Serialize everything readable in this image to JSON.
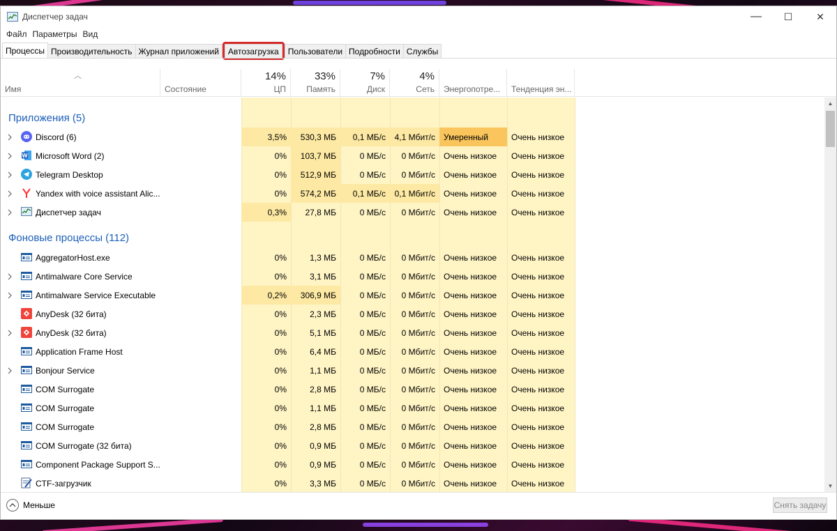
{
  "window": {
    "title": "Диспетчер задач",
    "minimize": "—",
    "maximize": "☐",
    "close": "✕"
  },
  "menu": [
    "Файл",
    "Параметры",
    "Вид"
  ],
  "tabs": [
    "Процессы",
    "Производительность",
    "Журнал приложений",
    "Автозагрузка",
    "Пользователи",
    "Подробности",
    "Службы"
  ],
  "active_tab": "Процессы",
  "highlighted_tab": "Автозагрузка",
  "columns": {
    "name": "Имя",
    "status": "Состояние",
    "cpu": {
      "pct": "14%",
      "label": "ЦП"
    },
    "memory": {
      "pct": "33%",
      "label": "Память"
    },
    "disk": {
      "pct": "7%",
      "label": "Диск"
    },
    "network": {
      "pct": "4%",
      "label": "Сеть"
    },
    "power": "Энергопотре...",
    "trend": "Тенденция эн..."
  },
  "sections": {
    "apps": "Приложения (5)",
    "background": "Фоновые процессы (112)"
  },
  "apps": [
    {
      "name": "Discord (6)",
      "icon": "discord-icon",
      "expand": true,
      "cpu": "3,5%",
      "mem": "530,3 МБ",
      "disk": "0,1 МБ/с",
      "net": "4,1 Мбит/с",
      "power": "Умеренный",
      "trend": "Очень низкое",
      "hot": true
    },
    {
      "name": "Microsoft Word (2)",
      "icon": "word-icon",
      "expand": true,
      "cpu": "0%",
      "mem": "103,7 МБ",
      "disk": "0 МБ/с",
      "net": "0 Мбит/с",
      "power": "Очень низкое",
      "trend": "Очень низкое"
    },
    {
      "name": "Telegram Desktop",
      "icon": "telegram-icon",
      "expand": true,
      "cpu": "0%",
      "mem": "512,9 МБ",
      "disk": "0 МБ/с",
      "net": "0 Мбит/с",
      "power": "Очень низкое",
      "trend": "Очень низкое"
    },
    {
      "name": "Yandex with voice assistant Alic...",
      "icon": "yandex-icon",
      "expand": true,
      "cpu": "0%",
      "mem": "574,2 МБ",
      "disk": "0,1 МБ/с",
      "net": "0,1 Мбит/с",
      "power": "Очень низкое",
      "trend": "Очень низкое"
    },
    {
      "name": "Диспетчер задач",
      "icon": "task-manager-icon",
      "expand": true,
      "cpu": "0,3%",
      "mem": "27,8 МБ",
      "disk": "0 МБ/с",
      "net": "0 Мбит/с",
      "power": "Очень низкое",
      "trend": "Очень низкое"
    }
  ],
  "background": [
    {
      "name": "AggregatorHost.exe",
      "icon": "service-icon",
      "expand": false,
      "cpu": "0%",
      "mem": "1,3 МБ",
      "disk": "0 МБ/с",
      "net": "0 Мбит/с",
      "power": "Очень низкое",
      "trend": "Очень низкое"
    },
    {
      "name": "Antimalware Core Service",
      "icon": "service-icon",
      "expand": true,
      "cpu": "0%",
      "mem": "3,1 МБ",
      "disk": "0 МБ/с",
      "net": "0 Мбит/с",
      "power": "Очень низкое",
      "trend": "Очень низкое"
    },
    {
      "name": "Antimalware Service Executable",
      "icon": "service-icon",
      "expand": true,
      "cpu": "0,2%",
      "mem": "306,9 МБ",
      "disk": "0 МБ/с",
      "net": "0 Мбит/с",
      "power": "Очень низкое",
      "trend": "Очень низкое"
    },
    {
      "name": "AnyDesk (32 бита)",
      "icon": "anydesk-icon",
      "expand": false,
      "cpu": "0%",
      "mem": "2,3 МБ",
      "disk": "0 МБ/с",
      "net": "0 Мбит/с",
      "power": "Очень низкое",
      "trend": "Очень низкое"
    },
    {
      "name": "AnyDesk (32 бита)",
      "icon": "anydesk-icon",
      "expand": true,
      "cpu": "0%",
      "mem": "5,1 МБ",
      "disk": "0 МБ/с",
      "net": "0 Мбит/с",
      "power": "Очень низкое",
      "trend": "Очень низкое"
    },
    {
      "name": "Application Frame Host",
      "icon": "service-icon",
      "expand": false,
      "cpu": "0%",
      "mem": "6,4 МБ",
      "disk": "0 МБ/с",
      "net": "0 Мбит/с",
      "power": "Очень низкое",
      "trend": "Очень низкое"
    },
    {
      "name": "Bonjour Service",
      "icon": "service-icon",
      "expand": true,
      "cpu": "0%",
      "mem": "1,1 МБ",
      "disk": "0 МБ/с",
      "net": "0 Мбит/с",
      "power": "Очень низкое",
      "trend": "Очень низкое"
    },
    {
      "name": "COM Surrogate",
      "icon": "service-icon",
      "expand": false,
      "cpu": "0%",
      "mem": "2,8 МБ",
      "disk": "0 МБ/с",
      "net": "0 Мбит/с",
      "power": "Очень низкое",
      "trend": "Очень низкое"
    },
    {
      "name": "COM Surrogate",
      "icon": "service-icon",
      "expand": false,
      "cpu": "0%",
      "mem": "1,1 МБ",
      "disk": "0 МБ/с",
      "net": "0 Мбит/с",
      "power": "Очень низкое",
      "trend": "Очень низкое"
    },
    {
      "name": "COM Surrogate",
      "icon": "service-icon",
      "expand": false,
      "cpu": "0%",
      "mem": "2,8 МБ",
      "disk": "0 МБ/с",
      "net": "0 Мбит/с",
      "power": "Очень низкое",
      "trend": "Очень низкое"
    },
    {
      "name": "COM Surrogate (32 бита)",
      "icon": "service-icon",
      "expand": false,
      "cpu": "0%",
      "mem": "0,9 МБ",
      "disk": "0 МБ/с",
      "net": "0 Мбит/с",
      "power": "Очень низкое",
      "trend": "Очень низкое"
    },
    {
      "name": "Component Package Support S...",
      "icon": "service-icon",
      "expand": false,
      "cpu": "0%",
      "mem": "0,9 МБ",
      "disk": "0 МБ/с",
      "net": "0 Мбит/с",
      "power": "Очень низкое",
      "trend": "Очень низкое"
    },
    {
      "name": "CTF-загрузчик",
      "icon": "ctf-icon",
      "expand": false,
      "cpu": "0%",
      "mem": "3,3 МБ",
      "disk": "0 МБ/с",
      "net": "0 Мбит/с",
      "power": "Очень низкое",
      "trend": "Очень низкое"
    }
  ],
  "footer": {
    "less": "Меньше",
    "end_task": "Снять задачу"
  },
  "colors": {
    "heat_light": "#fff4c4",
    "heat_mid": "#fde9a3",
    "heat_strong": "#f9c55c",
    "section": "#1c5fb8",
    "highlight": "#d42a2a"
  }
}
